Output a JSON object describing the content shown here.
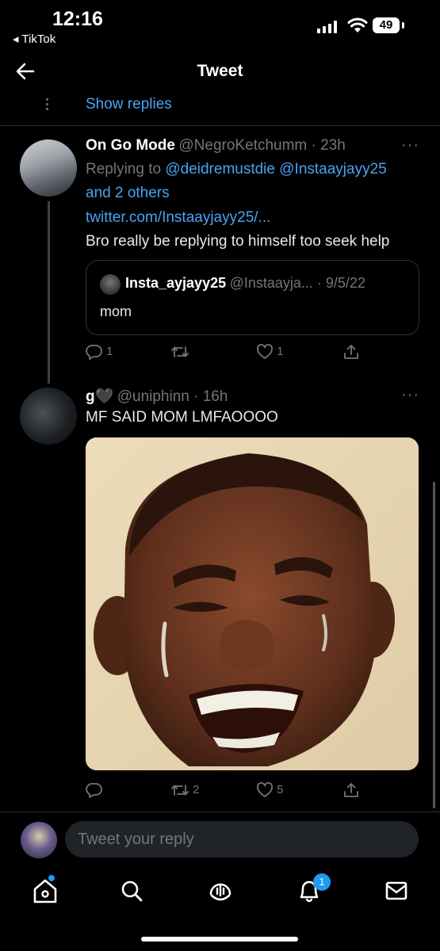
{
  "status_bar": {
    "time": "12:16",
    "back_app": "◂ TikTok",
    "battery": "49"
  },
  "header": {
    "title": "Tweet"
  },
  "thread": {
    "show_replies": "Show replies"
  },
  "tweet1": {
    "name": "On Go Mode",
    "handle_time": "@NegroKetchumm · 23h",
    "more": "···",
    "replying_prefix": "Replying to",
    "replying_handles": "@deidremustdie @Instaayjayy25",
    "replying_others": "and 2 others",
    "link": "twitter.com/Instaayjayy25/...",
    "text": "Bro really be replying to himself too seek help",
    "quote": {
      "name": "Insta_ayjayy25",
      "handle_time": "@Instaayja... · 9/5/22",
      "text": "mom"
    },
    "actions": {
      "replies": "1",
      "retweets": "",
      "likes": "1"
    }
  },
  "tweet2": {
    "name": "g🖤",
    "handle_time": "@uniphinn · 16h",
    "more": "···",
    "text": "MF SAID MOM LMFAOOOO",
    "actions": {
      "replies": "",
      "retweets": "2",
      "likes": "5"
    }
  },
  "reply_bar": {
    "placeholder": "Tweet your reply"
  },
  "tab_bar": {
    "items": [
      "home-icon",
      "search-icon",
      "spaces-icon",
      "notifications-icon",
      "messages-icon"
    ],
    "notifications_badge": "1"
  },
  "colors": {
    "background": "#000000",
    "accent": "#1d9bf0",
    "link": "#4aa3f0",
    "secondary_text": "#71767b"
  }
}
